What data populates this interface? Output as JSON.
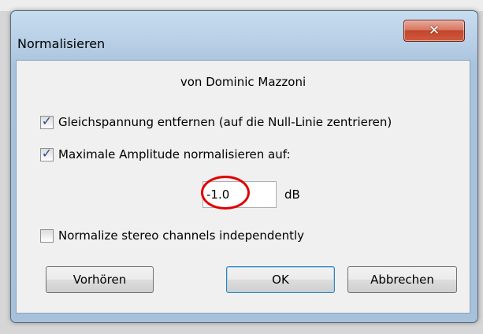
{
  "window": {
    "title": "Normalisieren",
    "close_glyph": "✕"
  },
  "dialog": {
    "author": "von Dominic Mazzoni",
    "options": [
      {
        "label": "Gleichspannung entfernen (auf die Null-Linie zentrieren)",
        "checked": true
      },
      {
        "label": "Maximale Amplitude normalisieren auf:",
        "checked": true
      },
      {
        "label": "Normalize stereo channels independently",
        "checked": false
      }
    ],
    "check_glyph": "✓",
    "amplitude": {
      "value": "-1.0",
      "unit": "dB"
    },
    "buttons": {
      "preview": "Vorhören",
      "ok": "OK",
      "cancel": "Abbrechen"
    }
  },
  "colors": {
    "highlight_ring": "#e00000",
    "close_button": "#c3452c"
  }
}
